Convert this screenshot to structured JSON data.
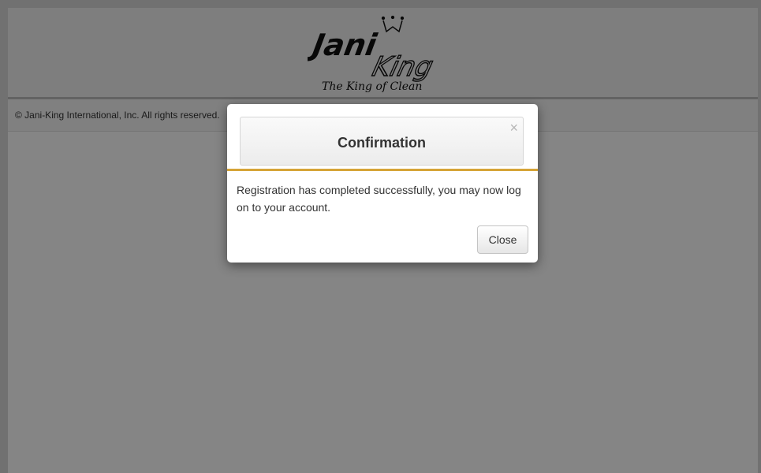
{
  "logo": {
    "wordmark_top": "Jani",
    "wordmark_bottom": "King",
    "tagline": "The King of Clean"
  },
  "footer": {
    "copyright": "© Jani-King International, Inc. All rights reserved."
  },
  "modal": {
    "title": "Confirmation",
    "close_icon": "×",
    "message": "Registration has completed successfully, you may now log on to your account.",
    "close_button_label": "Close"
  },
  "colors": {
    "accent_divider": "#d6a437",
    "overlay": "rgba(0,0,0,0.48)"
  }
}
